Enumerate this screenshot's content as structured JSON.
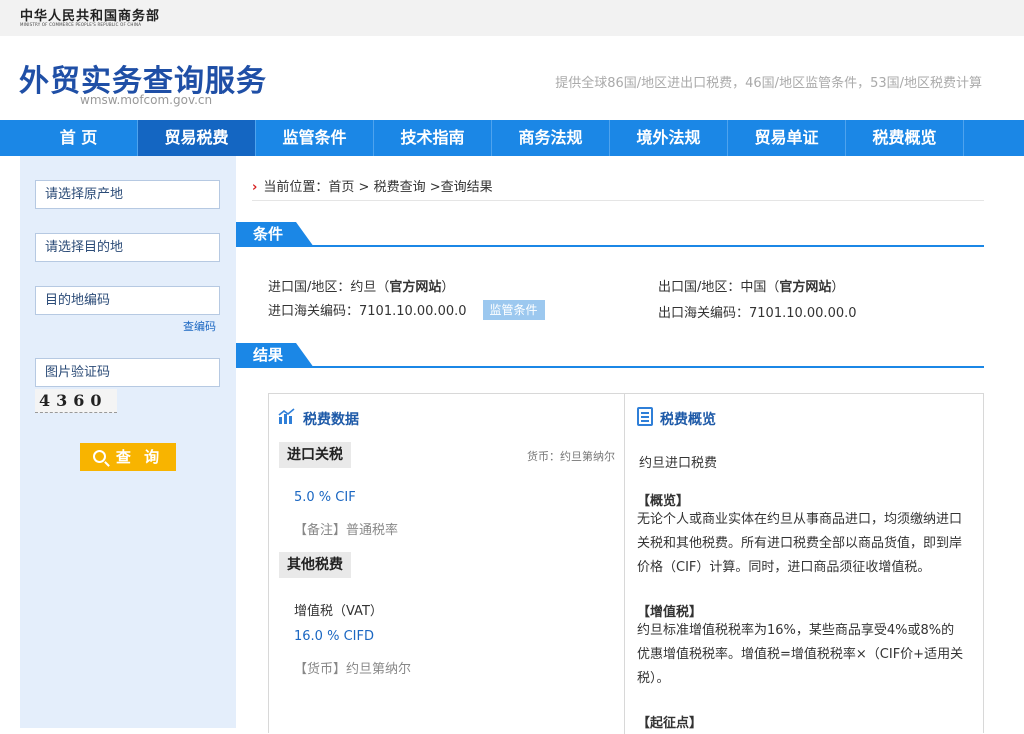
{
  "topbar": {
    "logo_cn": "中华人民共和国商务部",
    "logo_en": "MINISTRY OF COMMERCE PEOPLE'S REPUBLIC OF CHINA"
  },
  "header": {
    "title": "外贸实务查询服务",
    "domain": "wmsw.mofcom.gov.cn",
    "tagline": "提供全球86国/地区进出口税费，46国/地区监管条件，53国/地区税费计算"
  },
  "nav": {
    "items": [
      "首 页",
      "贸易税费",
      "监管条件",
      "技术指南",
      "商务法规",
      "境外法规",
      "贸易单证",
      "税费概览"
    ],
    "active_index": 1
  },
  "sidebar": {
    "origin_placeholder": "请选择原产地",
    "destination_placeholder": "请选择目的地",
    "code_placeholder": "目的地编码",
    "lookup_code_link": "查编码",
    "captcha_placeholder": "图片验证码",
    "captcha_text": "4360",
    "query_button": "查 询"
  },
  "breadcrumb": {
    "prefix": "当前位置：",
    "home": "首页",
    "sep1": " > ",
    "tax_query": "税费查询",
    "sep2": " >",
    "current": "查询结果"
  },
  "conditions": {
    "heading": "条件",
    "import_label": "进口国/地区：约旦（",
    "import_site": "官方网站",
    "import_close": "）",
    "export_label": "出口国/地区：中国（",
    "export_site": "官方网站",
    "export_close": "）",
    "import_hs": "进口海关编码：7101.10.00.00.0",
    "supervision_tag": "监管条件",
    "export_hs": "出口海关编码：7101.10.00.00.0"
  },
  "results": {
    "heading": "结果",
    "tax_data_title": "税费数据",
    "import_duty_label": "进口关税",
    "currency_note": "货币：约旦第纳尔",
    "import_duty_rate": "5.0 % CIF",
    "import_duty_remark": "【备注】普通税率",
    "other_tax_label": "其他税费",
    "vat_name": "增值税（VAT）",
    "vat_rate": "16.0 % CIFD",
    "vat_currency": "【货币】约旦第纳尔",
    "overview_title": "税费概览",
    "overview_subtitle": "约旦进口税费",
    "overview_h1": "【概览】",
    "overview_p1": "无论个人或商业实体在约旦从事商品进口，均须缴纳进口关税和其他税费。所有进口税费全部以商品货值，即到岸价格（CIF）计算。同时，进口商品须征收增值税。",
    "overview_h2": "【增值税】",
    "overview_p2": "约旦标准增值税税率为16%，某些商品享受4%或8%的优惠增值税税率。增值税=增值税税率×（CIF价+适用关税）。",
    "overview_h3": "【起征点】"
  }
}
